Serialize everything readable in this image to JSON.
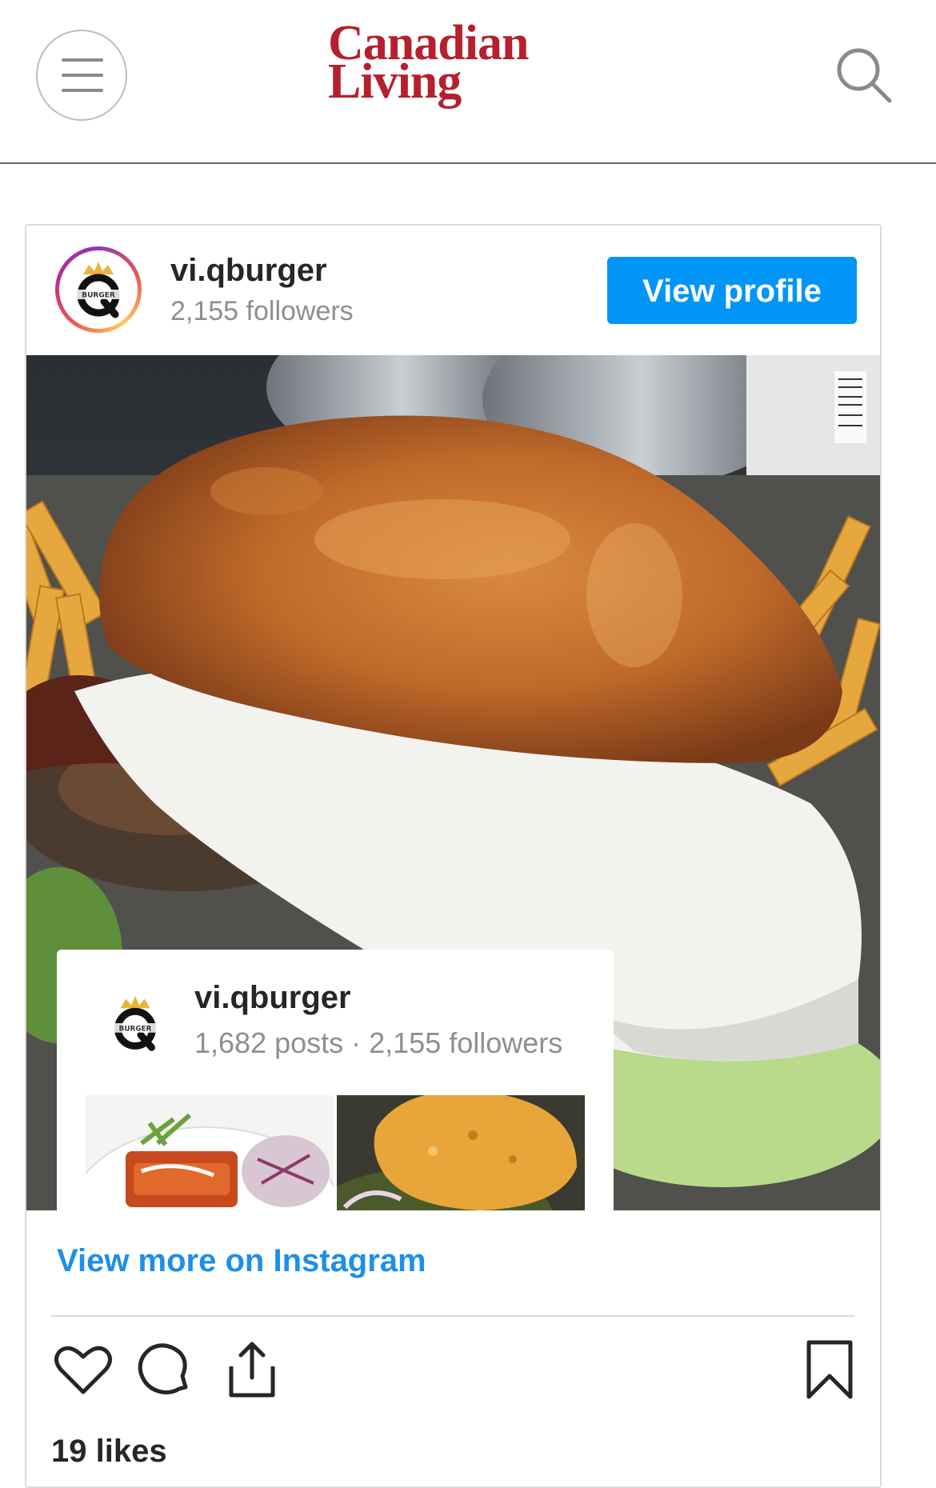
{
  "header": {
    "brand_line1": "Canadian",
    "brand_line2": "Living",
    "brand_color": "#b5202e",
    "menu_icon": "hamburger-menu-icon",
    "search_icon": "search-icon"
  },
  "embed": {
    "handle": "vi.qburger",
    "followers": "2,155 followers",
    "view_profile_label": "View profile",
    "button_color": "#0095f6",
    "profile_card": {
      "handle": "vi.qburger",
      "stats": "1,682 posts · 2,155 followers",
      "logo_text": "BURGER"
    },
    "view_more_label": "View more on Instagram",
    "link_color": "#1d8fe8",
    "actions": [
      "heart-icon",
      "comment-icon",
      "share-icon",
      "bookmark-icon"
    ],
    "likes": "19 likes"
  }
}
